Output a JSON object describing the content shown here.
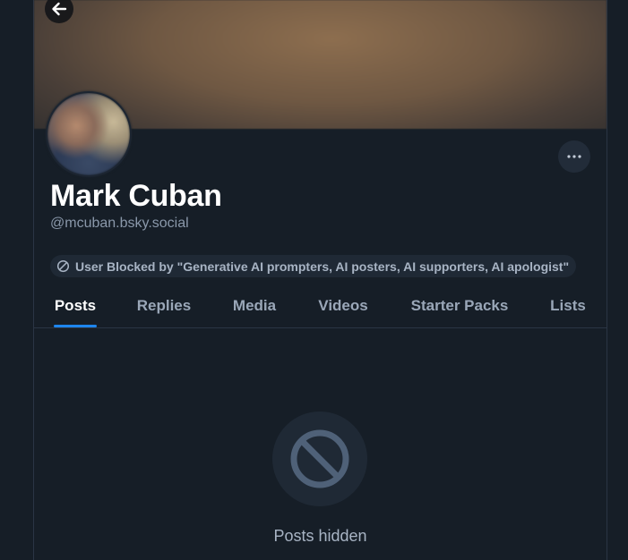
{
  "profile": {
    "display_name": "Mark Cuban",
    "handle": "@mcuban.bsky.social",
    "blocked_notice": "User Blocked by \"Generative AI prompters, AI posters, AI supporters, AI apologist\""
  },
  "tabs": [
    {
      "label": "Posts",
      "active": true
    },
    {
      "label": "Replies",
      "active": false
    },
    {
      "label": "Media",
      "active": false
    },
    {
      "label": "Videos",
      "active": false
    },
    {
      "label": "Starter Packs",
      "active": false
    },
    {
      "label": "Lists",
      "active": false
    }
  ],
  "empty_state": {
    "label": "Posts hidden",
    "icon": "blocked-icon"
  },
  "icons": {
    "back": "arrow-left-icon",
    "more": "ellipsis-icon",
    "block": "block-icon"
  },
  "colors": {
    "background": "#161e27",
    "accent": "#1e86ee",
    "text_primary": "#ffffff",
    "text_secondary": "#8a98aa"
  }
}
